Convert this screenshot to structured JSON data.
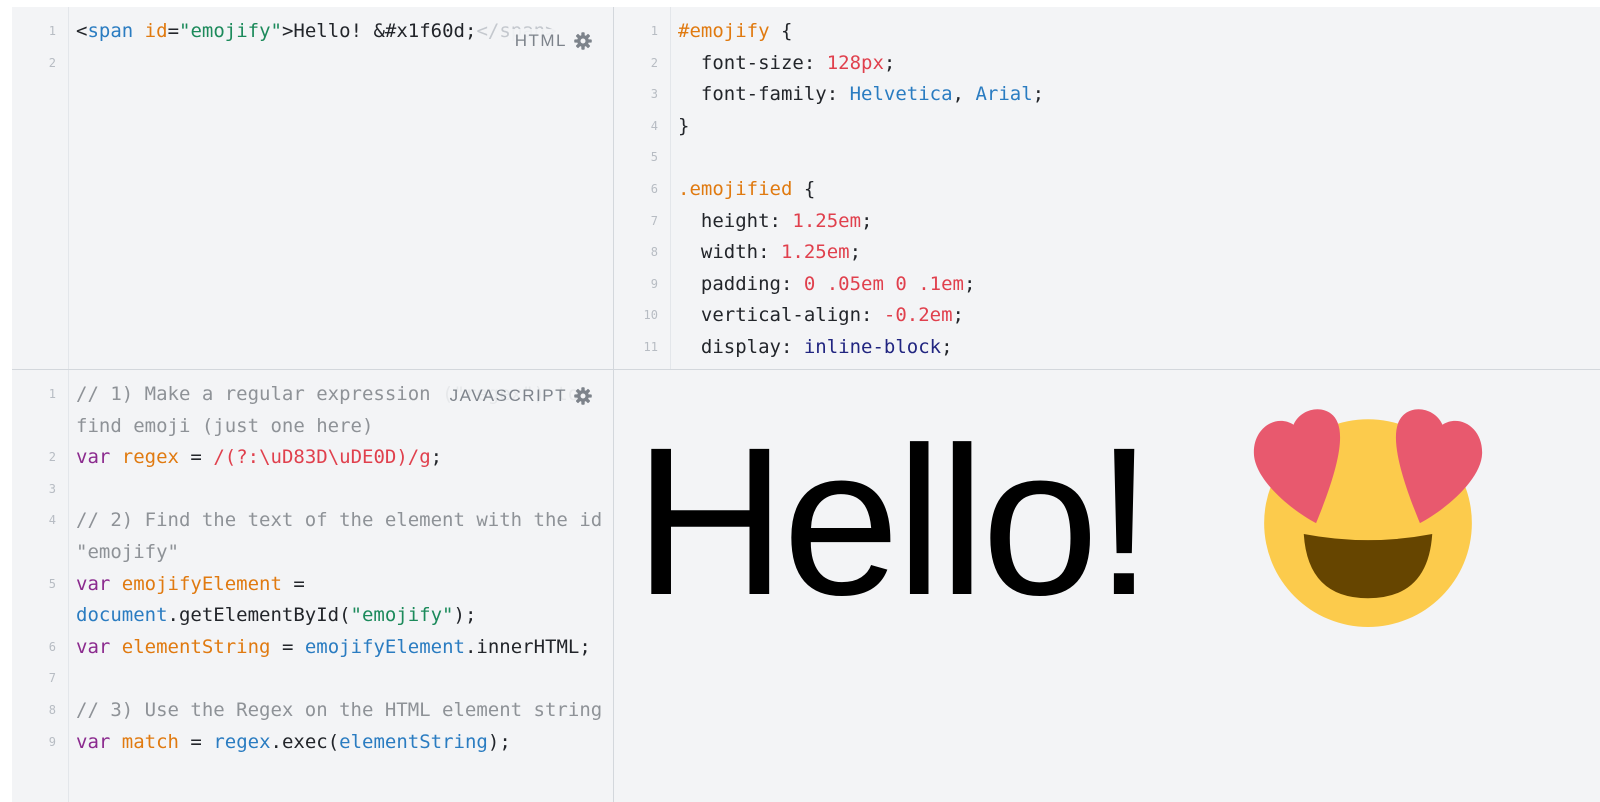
{
  "html_panel": {
    "label": "HTML",
    "lines": [
      {
        "num": "1",
        "text": "<span id=\"emojify\">Hello! &#x1f60d;</span>"
      },
      {
        "num": "2",
        "text": ""
      }
    ]
  },
  "css_panel": {
    "lines": [
      {
        "num": "1",
        "text": "#emojify {"
      },
      {
        "num": "2",
        "text": "  font-size: 128px;"
      },
      {
        "num": "3",
        "text": "  font-family: Helvetica, Arial;"
      },
      {
        "num": "4",
        "text": "}"
      },
      {
        "num": "5",
        "text": ""
      },
      {
        "num": "6",
        "text": ".emojified {"
      },
      {
        "num": "7",
        "text": "  height: 1.25em;"
      },
      {
        "num": "8",
        "text": "  width: 1.25em;"
      },
      {
        "num": "9",
        "text": "  padding: 0 .05em 0 .1em;"
      },
      {
        "num": "10",
        "text": "  vertical-align: -0.2em;"
      },
      {
        "num": "11",
        "text": "  display: inline-block;"
      }
    ]
  },
  "js_panel": {
    "label": "JAVASCRIPT",
    "lines": [
      {
        "num": "1",
        "text": "// 1) Make a regular expression (\"regex\") to find emoji (just one here)"
      },
      {
        "num": "2",
        "text": "var regex = /(?:\\uD83D\\uDE0D)/g;"
      },
      {
        "num": "3",
        "text": ""
      },
      {
        "num": "4",
        "text": "// 2) Find the text of the element with the id \"emojify\""
      },
      {
        "num": "5",
        "text": "var emojifyElement = document.getElementById(\"emojify\");"
      },
      {
        "num": "6",
        "text": "var elementString = emojifyElement.innerHTML;"
      },
      {
        "num": "7",
        "text": ""
      },
      {
        "num": "8",
        "text": "// 3) Use the Regex on the HTML element string"
      },
      {
        "num": "9",
        "text": "var match = regex.exec(elementString);"
      }
    ]
  },
  "result_panel": {
    "text": "Hello!",
    "emoji_icon": "heart-eyes-emoji-icon"
  },
  "colors": {
    "panel_bg": "#f3f4f6",
    "keyword": "#8b2a8e",
    "variable": "#e07a10",
    "function": "#2a7cc1",
    "string": "#1c8a5b",
    "number": "#e0404d",
    "comment": "#8e9297",
    "emoji_face": "#fccb4c",
    "emoji_heart": "#e8596e",
    "emoji_mouth": "#664500"
  }
}
